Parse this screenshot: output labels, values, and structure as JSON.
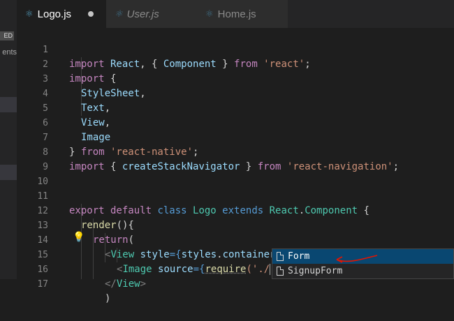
{
  "sidebar": {
    "badge": "ED",
    "label": "ents"
  },
  "tabs": [
    {
      "label": "Logo.js",
      "active": true,
      "modified": true
    },
    {
      "label": "User.js",
      "active": false
    },
    {
      "label": "Home.js",
      "active": false
    }
  ],
  "line_numbers": [
    "1",
    "2",
    "3",
    "4",
    "5",
    "6",
    "7",
    "8",
    "9",
    "10",
    "11",
    "12",
    "13",
    "14",
    "15",
    "16",
    "17"
  ],
  "code": {
    "l1": [
      "import",
      " React",
      ", { ",
      "Component",
      " } ",
      "from",
      " 'react'",
      ";"
    ],
    "l2": [
      "import",
      " {"
    ],
    "l3": [
      "StyleSheet",
      ","
    ],
    "l4": [
      "Text",
      ","
    ],
    "l5": [
      "View",
      ","
    ],
    "l6": [
      "Image"
    ],
    "l7": [
      "} ",
      "from",
      " 'react-native'",
      ";"
    ],
    "l8": [
      "import",
      " { ",
      "createStackNavigator",
      " } ",
      "from",
      " 'react-navigation'",
      ";"
    ],
    "l11": [
      "export",
      " default",
      " class",
      " Logo",
      " extends",
      " React",
      ".",
      "Component",
      " {"
    ],
    "l12": [
      "render",
      "(){"
    ],
    "l13": [
      "return",
      "("
    ],
    "l14": [
      "<",
      "View",
      " style",
      "={",
      "styles",
      ".",
      "container",
      "}>"
    ],
    "l15": [
      "<",
      "Image",
      " source",
      "={",
      "require",
      "('./",
      "')}",
      " />"
    ],
    "l16": [
      "</",
      "View",
      ">"
    ],
    "l17": [
      ")"
    ]
  },
  "suggestions": [
    {
      "label": "Form",
      "selected": true
    },
    {
      "label": "SignupForm",
      "selected": false
    }
  ],
  "colors": {
    "accent": "#094771",
    "keyword": "#c586c0",
    "string": "#ce9178",
    "type": "#4ec9b0"
  }
}
